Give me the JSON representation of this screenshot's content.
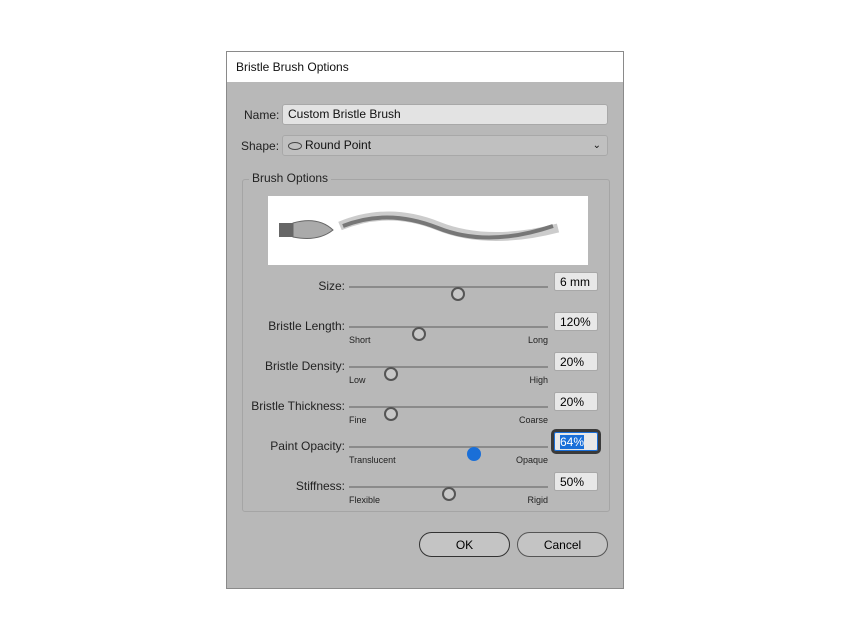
{
  "dialog": {
    "title": "Bristle Brush Options"
  },
  "name": {
    "label": "Name:",
    "value": "Custom Bristle Brush"
  },
  "shape": {
    "label": "Shape:",
    "value": "Round Point",
    "icon": "round-point-icon"
  },
  "group": {
    "label": "Brush Options"
  },
  "sliders": [
    {
      "label": "Size:",
      "value": "6 mm",
      "position": 0.55,
      "low": "",
      "high": ""
    },
    {
      "label": "Bristle Length:",
      "value": "120%",
      "position": 0.35,
      "low": "Short",
      "high": "Long"
    },
    {
      "label": "Bristle Density:",
      "value": "20%",
      "position": 0.21,
      "low": "Low",
      "high": "High"
    },
    {
      "label": "Bristle Thickness:",
      "value": "20%",
      "position": 0.21,
      "low": "Fine",
      "high": "Coarse"
    },
    {
      "label": "Paint Opacity:",
      "value": "64%",
      "position": 0.63,
      "low": "Translucent",
      "high": "Opaque",
      "active": true
    },
    {
      "label": "Stiffness:",
      "value": "50%",
      "position": 0.5,
      "low": "Flexible",
      "high": "Rigid"
    }
  ],
  "buttons": {
    "ok": "OK",
    "cancel": "Cancel"
  },
  "colors": {
    "accent": "#1a6fd8",
    "panel": "#b8b8b8"
  }
}
